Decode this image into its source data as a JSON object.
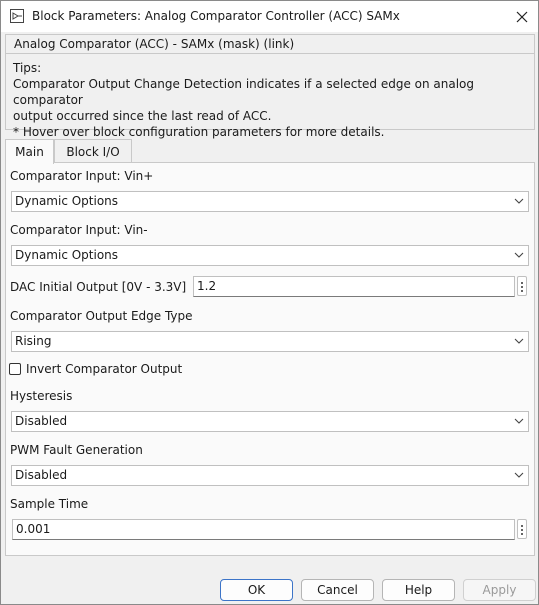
{
  "window": {
    "title": "Block Parameters: Analog Comparator Controller (ACC) SAMx"
  },
  "description": {
    "title": "Analog Comparator  (ACC) - SAMx (mask) (link)",
    "lines": [
      "Tips:",
      "Comparator Output Change Detection indicates if a selected edge on analog comparator",
      "output occurred since the last read of ACC.",
      "* Hover over block configuration parameters for more details."
    ]
  },
  "tabs": [
    {
      "label": "Main",
      "active": true
    },
    {
      "label": "Block I/O",
      "active": false
    }
  ],
  "params": {
    "vin_plus": {
      "label": "Comparator Input: Vin+",
      "value": "Dynamic Options"
    },
    "vin_minus": {
      "label": "Comparator Input: Vin-",
      "value": "Dynamic Options"
    },
    "dac": {
      "label": "DAC Initial Output [0V - 3.3V]",
      "value": "1.2"
    },
    "edge_type": {
      "label": "Comparator Output Edge Type",
      "value": "Rising"
    },
    "invert": {
      "label": "Invert Comparator Output",
      "checked": false
    },
    "hysteresis": {
      "label": "Hysteresis",
      "value": "Disabled"
    },
    "pwm_fault": {
      "label": "PWM Fault Generation",
      "value": "Disabled"
    },
    "sample_time": {
      "label": "Sample Time",
      "value": "0.001"
    }
  },
  "buttons": {
    "ok": "OK",
    "cancel": "Cancel",
    "help": "Help",
    "apply": "Apply"
  },
  "colors": {
    "primary_border": "#3c74c8",
    "window_bg": "#f0f0f0",
    "panel_bg": "#fafafa"
  }
}
